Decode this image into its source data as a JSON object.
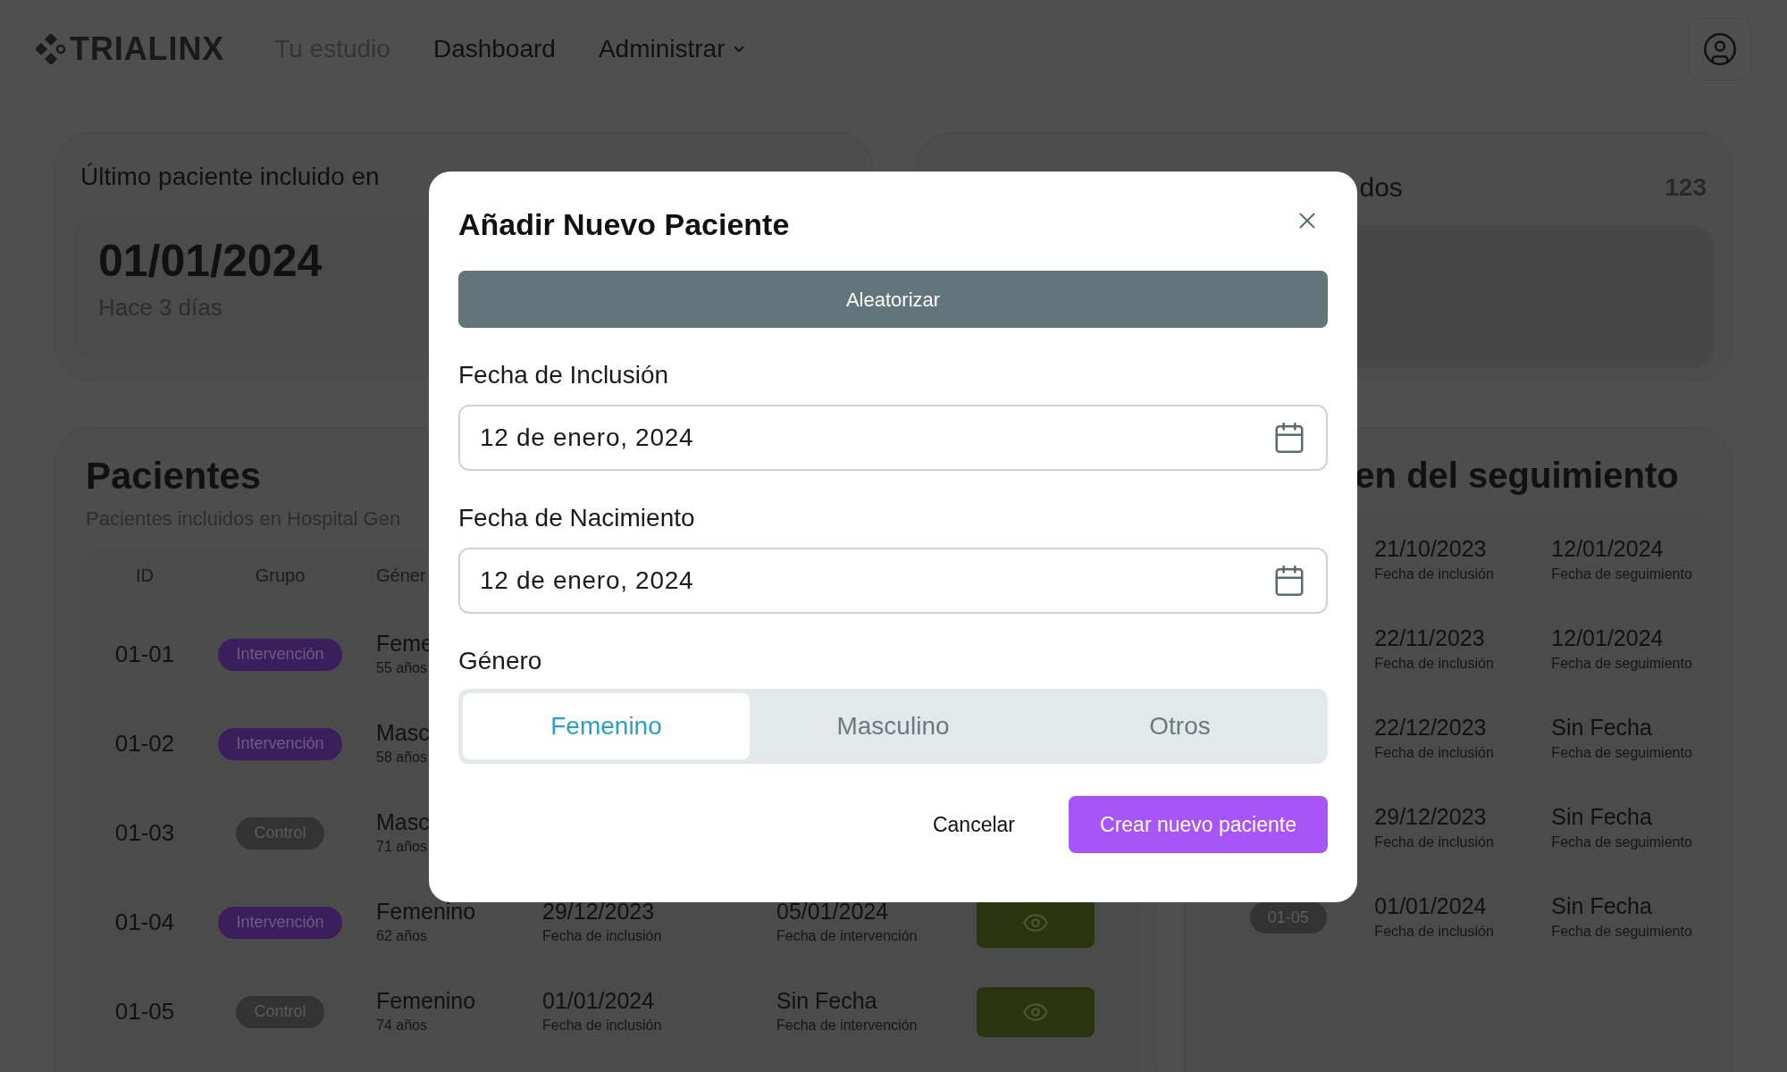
{
  "header": {
    "brand": "TRIALINX",
    "nav": [
      {
        "label": "Tu estudio",
        "disabled": true,
        "dropdown": false
      },
      {
        "label": "Dashboard",
        "disabled": false,
        "dropdown": false
      },
      {
        "label": "Administrar",
        "disabled": false,
        "dropdown": true
      }
    ]
  },
  "last_patient_card": {
    "title": "Último paciente incluido en",
    "date": "01/01/2024",
    "relative": "Hace 3 días"
  },
  "count_card": {
    "title": "dos",
    "count": "123"
  },
  "patients": {
    "title": "Pacientes",
    "subtitle": "Pacientes incluidos en Hospital Gen",
    "columns": [
      "ID",
      "Grupo",
      "Géner"
    ],
    "rows": [
      {
        "id": "01-01",
        "group": {
          "label": "Intervención",
          "kind": "intervention"
        },
        "gender": "Feme",
        "age": "55 años"
      },
      {
        "id": "01-02",
        "group": {
          "label": "Intervención",
          "kind": "intervention"
        },
        "gender": "Masc",
        "age": "58 años"
      },
      {
        "id": "01-03",
        "group": {
          "label": "Control",
          "kind": "control"
        },
        "gender": "Masc",
        "age": "71 años"
      },
      {
        "id": "01-04",
        "group": {
          "label": "Intervención",
          "kind": "intervention"
        },
        "gender": "Femenino",
        "age": "62 años",
        "inclusion_date": "29/12/2023",
        "inclusion_label": "Fecha de inclusión",
        "intervention_date": "05/01/2024",
        "intervention_label": "Fecha de intervención"
      },
      {
        "id": "01-05",
        "group": {
          "label": "Control",
          "kind": "control"
        },
        "gender": "Femenino",
        "age": "74 años",
        "inclusion_date": "01/01/2024",
        "inclusion_label": "Fecha de inclusión",
        "intervention_date": "Sin Fecha",
        "intervention_label": "Fecha de intervención"
      }
    ]
  },
  "followup": {
    "title": "en del seguimiento",
    "rows": [
      {
        "inclusion": "21/10/2023",
        "inclusion_label": "Fecha de inclusión",
        "followup": "12/01/2024",
        "followup_label": "Fecha de seguimiento"
      },
      {
        "inclusion": "22/11/2023",
        "inclusion_label": "Fecha de inclusión",
        "followup": "12/01/2024",
        "followup_label": "Fecha de seguimiento"
      },
      {
        "inclusion": "22/12/2023",
        "inclusion_label": "Fecha de inclusión",
        "followup": "Sin Fecha",
        "followup_label": "Fecha de seguimiento"
      },
      {
        "inclusion": "29/12/2023",
        "inclusion_label": "Fecha de inclusión",
        "followup": "Sin Fecha",
        "followup_label": "Fecha de seguimiento"
      },
      {
        "id": "01-05",
        "inclusion": "01/01/2024",
        "inclusion_label": "Fecha de inclusión",
        "followup": "Sin Fecha",
        "followup_label": "Fecha de seguimiento"
      }
    ]
  },
  "modal": {
    "title": "Añadir Nuevo Paciente",
    "randomize": "Aleatorizar",
    "fields": [
      {
        "label": "Fecha de Inclusión",
        "value": "12 de enero, 2024"
      },
      {
        "label": "Fecha de Nacimiento",
        "value": "12 de enero, 2024"
      }
    ],
    "gender_label": "Género",
    "gender_options": [
      {
        "label": "Femenino",
        "selected": true
      },
      {
        "label": "Masculino",
        "selected": false
      },
      {
        "label": "Otros",
        "selected": false
      }
    ],
    "cancel": "Cancelar",
    "submit": "Crear nuevo paciente"
  }
}
